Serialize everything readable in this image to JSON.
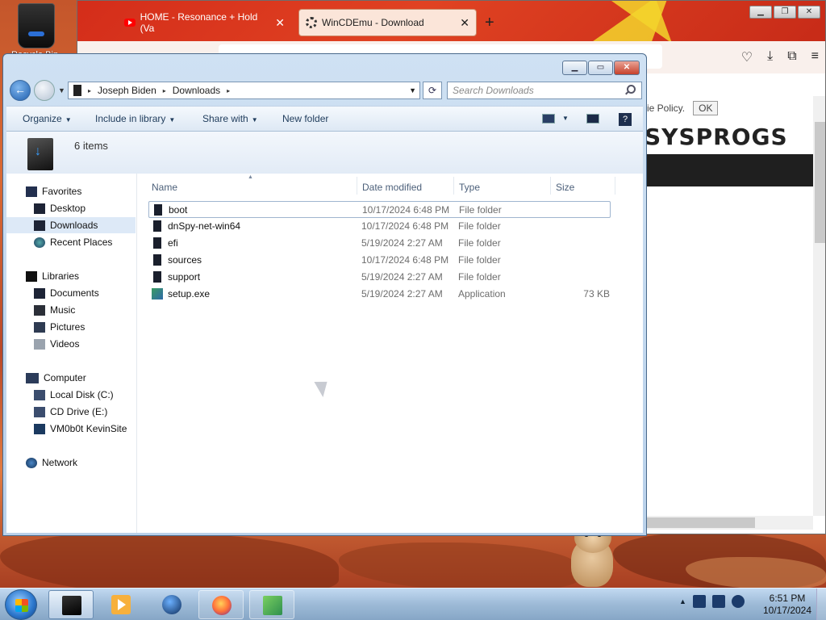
{
  "desktop": {
    "recycle_bin_label": "Recycle Bin"
  },
  "firefox": {
    "tabs": [
      {
        "title": "HOME - Resonance + Hold (Va"
      },
      {
        "title": "WinCDEmu - Download"
      }
    ],
    "new_tab": "+",
    "cookie_text": "kie Policy.",
    "cookie_ok": "OK",
    "site_logo": "SYSPROGS",
    "window_buttons": {
      "minimize": "▁",
      "restore": "❐",
      "close": "✕"
    },
    "tools": {
      "pocket": "♡",
      "download": "⤓",
      "extensions": "⧉",
      "menu": "≡"
    }
  },
  "explorer": {
    "caption": {
      "minimize": "▁",
      "maximize": "▭",
      "close": "✕"
    },
    "breadcrumb": [
      "Joseph Biden",
      "Downloads"
    ],
    "breadcrumb_sep": "▸",
    "refresh": "⟳",
    "search_placeholder": "Search Downloads",
    "toolbar": {
      "organize": "Organize",
      "include_in_library": "Include in library",
      "share_with": "Share with",
      "new_folder": "New folder",
      "help": "?"
    },
    "item_count": "6 items",
    "nav": {
      "favorites": "Favorites",
      "desktop": "Desktop",
      "downloads": "Downloads",
      "recent_places": "Recent Places",
      "libraries": "Libraries",
      "documents": "Documents",
      "music": "Music",
      "pictures": "Pictures",
      "videos": "Videos",
      "computer": "Computer",
      "local_disk": "Local Disk (C:)",
      "cd_drive": "CD Drive (E:)",
      "vm_share": "VM0b0t KevinSite",
      "network": "Network"
    },
    "columns": {
      "name": "Name",
      "date": "Date modified",
      "type": "Type",
      "size": "Size"
    },
    "files": [
      {
        "name": "boot",
        "date": "10/17/2024 6:48 PM",
        "type": "File folder",
        "size": ""
      },
      {
        "name": "dnSpy-net-win64",
        "date": "10/17/2024 6:48 PM",
        "type": "File folder",
        "size": ""
      },
      {
        "name": "efi",
        "date": "5/19/2024 2:27 AM",
        "type": "File folder",
        "size": ""
      },
      {
        "name": "sources",
        "date": "10/17/2024 6:48 PM",
        "type": "File folder",
        "size": ""
      },
      {
        "name": "support",
        "date": "5/19/2024 2:27 AM",
        "type": "File folder",
        "size": ""
      },
      {
        "name": "setup.exe",
        "date": "5/19/2024 2:27 AM",
        "type": "Application",
        "size": "73 KB"
      }
    ]
  },
  "taskbar": {
    "clock_time": "6:51 PM",
    "clock_date": "10/17/2024",
    "tray_expand": "▲"
  }
}
